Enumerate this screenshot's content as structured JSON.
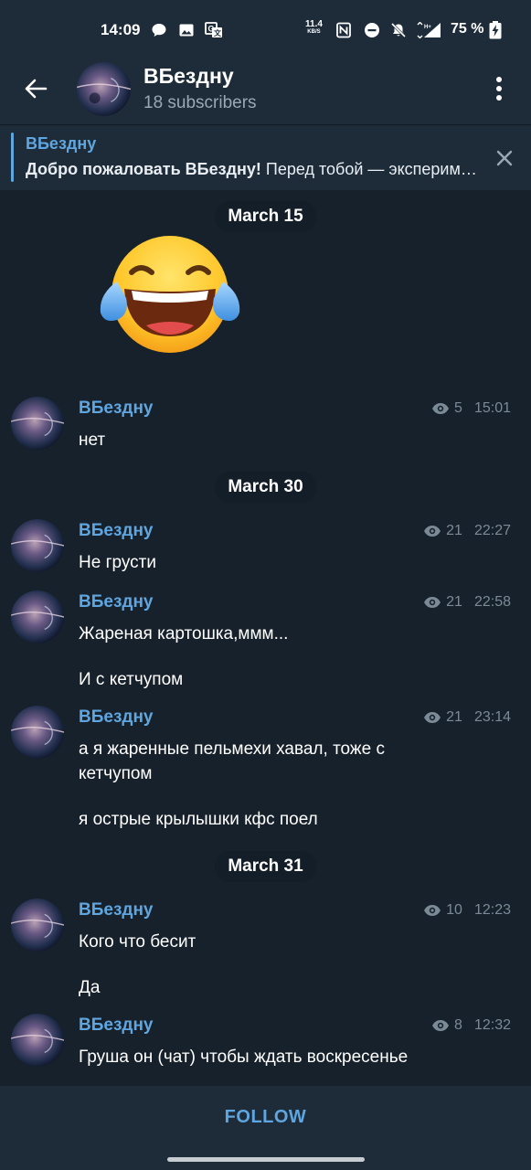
{
  "status_bar": {
    "time": "14:09",
    "net_speed": "11.4",
    "net_unit": "KB/S",
    "network_type": "H+",
    "battery_percent": "75 %"
  },
  "header": {
    "title": "ВБездну",
    "subtitle": "18 subscribers"
  },
  "pinned": {
    "title": "ВБездну",
    "text_bold": "Добро пожаловать ВБездну!",
    "text_rest": " Перед тобой — экспериментальный канал"
  },
  "dates": [
    "March 15",
    "March 30",
    "March 31"
  ],
  "sticker": {
    "name": "face-with-tears-of-joy"
  },
  "messages": [
    {
      "author": "ВБездну",
      "views": "5",
      "time": "15:01",
      "lines": [
        "нет"
      ]
    },
    {
      "author": "ВБездну",
      "views": "21",
      "time": "22:27",
      "lines": [
        "Не грусти"
      ]
    },
    {
      "author": "ВБездну",
      "views": "21",
      "time": "22:58",
      "lines": [
        "Жареная картошка,ммм...",
        "И с кетчупом"
      ]
    },
    {
      "author": "ВБездну",
      "views": "21",
      "time": "23:14",
      "lines": [
        "а я жаренные пельмехи хавал, тоже с кетчупом",
        "я острые крылышки кфс поел"
      ]
    },
    {
      "author": "ВБездну",
      "views": "10",
      "time": "12:23",
      "lines": [
        "Кого что бесит",
        "Да"
      ]
    },
    {
      "author": "ВБездну",
      "views": "8",
      "time": "12:32",
      "lines": [
        "Груша он (чат) чтобы ждать воскресенье"
      ]
    }
  ],
  "follow": {
    "label": "FOLLOW"
  },
  "colors": {
    "background": "#17212b",
    "header": "#1e2c3a",
    "accent": "#5fa6e0"
  }
}
